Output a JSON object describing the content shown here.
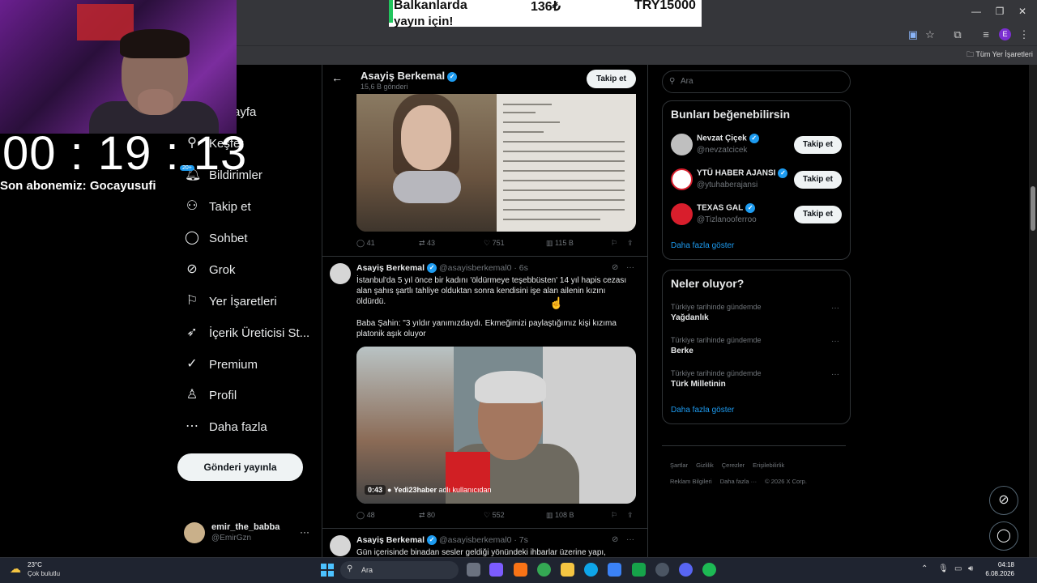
{
  "browser": {
    "bookmarks_all": "Tüm Yer İşaretleri",
    "profile_letter": "E"
  },
  "ad": {
    "line1": "Balkanlarda",
    "line2": "yayın için!",
    "price": "136₺",
    "price_try": "TRY15000"
  },
  "stream": {
    "timer": "00 : 19 : 13",
    "subscriber": "Son abonemiz: Gocayusufi",
    "notif_count": "20+"
  },
  "nav": {
    "items": [
      {
        "label": "Anasayfa",
        "icon": "home-icon"
      },
      {
        "label": "Keşfet",
        "icon": "search-icon"
      },
      {
        "label": "Bildirimler",
        "icon": "bell-icon"
      },
      {
        "label": "Takip et",
        "icon": "add-person-icon"
      },
      {
        "label": "Sohbet",
        "icon": "chat-icon"
      },
      {
        "label": "Grok",
        "icon": "grok-icon"
      },
      {
        "label": "Yer İşaretleri",
        "icon": "bookmark-icon"
      },
      {
        "label": "İçerik Üreticisi St...",
        "icon": "rocket-icon"
      },
      {
        "label": "Premium",
        "icon": "verified-icon"
      },
      {
        "label": "Profil",
        "icon": "profile-icon"
      },
      {
        "label": "Daha fazla",
        "icon": "more-circle-icon"
      }
    ],
    "nav_visible_anasayfa": "ayfa",
    "post_button": "Gönderi yayınla"
  },
  "me": {
    "name": "emir_the_babba",
    "handle": "@EmirGzn"
  },
  "column": {
    "title": "Asayiş Berkemal",
    "subtitle": "15,6 B gönderi",
    "follow": "Takip et"
  },
  "tweet1": {
    "replies": "41",
    "retweets": "43",
    "likes": "751",
    "views": "115 B"
  },
  "tweet2": {
    "name": "Asayiş Berkemal",
    "handle": "@asayisberkemal0 · 6s",
    "text1": "İstanbul'da 5 yıl önce bir kadını 'öldürmeye teşebbüsten' 14 yıl hapis cezası alan şahıs şartlı tahliye olduktan sonra kendisini işe alan ailenin kızını öldürdü.",
    "text2": "Baba Şahin: \"3 yıldır yanımızdaydı. Ekmeğimizi paylaştığımız kişi kızıma platonik aşık oluyor",
    "video_duration": "0:43",
    "video_by_user": "Yedi23haber",
    "video_by_suffix": "adlı kullanıcıdan",
    "replies": "48",
    "retweets": "80",
    "likes": "552",
    "views": "108 B"
  },
  "tweet3": {
    "name": "Asayiş Berkemal",
    "handle": "@asayisberkemal0 · 7s",
    "text": "Gün içerisinde binadan sesler geldiği yönündeki ihbarlar üzerine yapı,"
  },
  "sidebar": {
    "search_placeholder": "Ara",
    "who_title": "Bunları beğenebilirsin",
    "suggestions": [
      {
        "name": "Nevzat Çiçek",
        "handle": "@nevzatcicek",
        "follow": "Takip et",
        "avatar_color": "#bfbfbf"
      },
      {
        "name": "YTÜ HABER AJANSI",
        "handle": "@ytuhaberajansi",
        "follow": "Takip et",
        "avatar_color": "#ffffff"
      },
      {
        "name": "TEXAS GAL",
        "handle": "@Tizlanooferroo",
        "follow": "Takip et",
        "avatar_color": "#d81e2c"
      }
    ],
    "show_more": "Daha fazla göster",
    "trend_title": "Neler oluyor?",
    "trends": [
      {
        "context": "Türkiye tarihinde gündemde",
        "name": "Yağdanlık"
      },
      {
        "context": "Türkiye tarihinde gündemde",
        "name": "Berke"
      },
      {
        "context": "Türkiye tarihinde gündemde",
        "name": "Türk Milletinin"
      }
    ],
    "trend_show_more": "Daha fazla göster",
    "footer": [
      "Şartlar",
      "Gizlilik",
      "Çerezler",
      "Erişilebilirlik",
      "Reklam Bilgileri",
      "Daha fazla ···",
      "© 2026 X Corp."
    ]
  },
  "taskbar": {
    "temp": "23°C",
    "weather": "Çok bulutlu",
    "search": "Ara",
    "time": "04:18",
    "date": "6.08.2026"
  }
}
